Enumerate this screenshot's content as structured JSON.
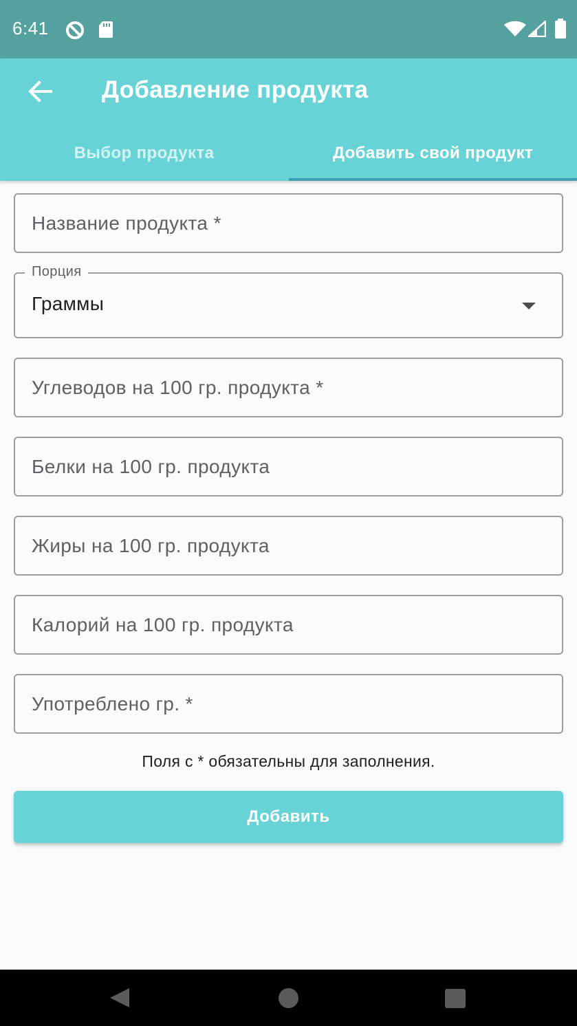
{
  "status_bar": {
    "time": "6:41",
    "left_icons": [
      "sync-icon",
      "sd-card-icon"
    ],
    "right_icons": [
      "wifi-icon",
      "signal-icon",
      "battery-icon"
    ]
  },
  "app_bar": {
    "back_icon": "arrow-back-icon",
    "title": "Добавление продукта"
  },
  "tabs": [
    {
      "label": "Выбор продукта",
      "active": false
    },
    {
      "label": "Добавить свой продукт",
      "active": true
    }
  ],
  "form": {
    "product_name": {
      "placeholder": "Название продукта *",
      "value": ""
    },
    "portion": {
      "label": "Порция",
      "value": "Граммы",
      "icon": "dropdown-arrow-icon"
    },
    "carbs": {
      "placeholder": "Углеводов на 100 гр. продукта *",
      "value": ""
    },
    "proteins": {
      "placeholder": "Белки на 100 гр. продукта",
      "value": ""
    },
    "fats": {
      "placeholder": "Жиры на 100 гр. продукта",
      "value": ""
    },
    "calories": {
      "placeholder": "Калорий на 100 гр. продукта",
      "value": ""
    },
    "consumed": {
      "placeholder": "Употреблено гр. *",
      "value": ""
    },
    "hint": "Поля с * обязательны для заполнения.",
    "submit_label": "Добавить"
  },
  "colors": {
    "status_bar": "#55a19f",
    "primary": "#67d3d6",
    "tab_indicator": "#3d9fb3",
    "background": "#f9fafb"
  },
  "nav_bar": {
    "icons": [
      "nav-back-icon",
      "nav-home-icon",
      "nav-recents-icon"
    ]
  }
}
